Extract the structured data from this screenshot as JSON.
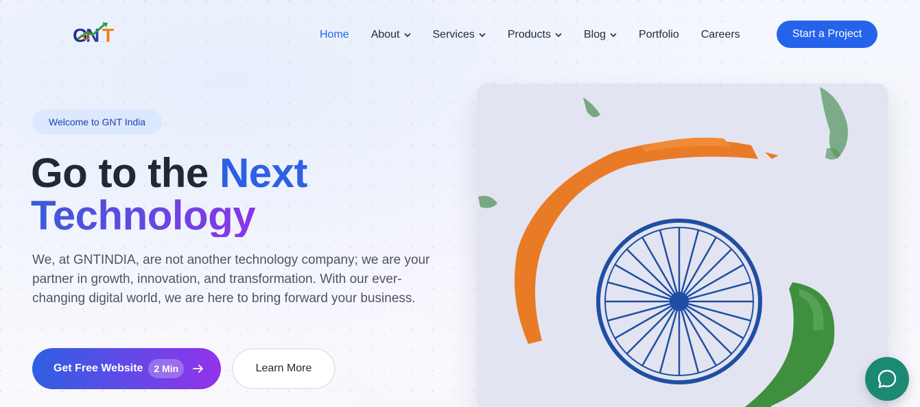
{
  "brand": {
    "logo_text": "GNT",
    "logo_icon": "gnt-logo-icon"
  },
  "nav": {
    "items": [
      {
        "label": "Home",
        "active": true,
        "has_dropdown": false
      },
      {
        "label": "About",
        "active": false,
        "has_dropdown": true
      },
      {
        "label": "Services",
        "active": false,
        "has_dropdown": true
      },
      {
        "label": "Products",
        "active": false,
        "has_dropdown": true
      },
      {
        "label": "Blog",
        "active": false,
        "has_dropdown": true
      },
      {
        "label": "Portfolio",
        "active": false,
        "has_dropdown": false
      },
      {
        "label": "Careers",
        "active": false,
        "has_dropdown": false
      }
    ],
    "cta_label": "Start a Project"
  },
  "hero": {
    "badge": "Welcome to GNT India",
    "title_part1": "Go to the ",
    "title_highlight": "Next",
    "title_line2": "Technology",
    "description": "We, at GNTINDIA, are not another technology company; we are your partner in growth, innovation, and transformation. With our ever-changing digital world, we are here to bring forward your business.",
    "primary_button": {
      "label": "Get Free Website",
      "pill": "2 Min",
      "icon": "arrow-right-icon"
    },
    "secondary_button": {
      "label": "Learn More"
    },
    "image": {
      "subject": "tricolor-ashoka-chakra",
      "icon": "ashoka-chakra-icon"
    }
  },
  "chat": {
    "icon": "chat-bubble-icon"
  },
  "colors": {
    "accent": "#2563eb",
    "gradient_start": "#2f5fe3",
    "gradient_end": "#9333ea",
    "saffron": "#ea7b26",
    "green": "#3f8f3f",
    "chakra_blue": "#1e4fa3",
    "chat": "#1c8a73"
  }
}
